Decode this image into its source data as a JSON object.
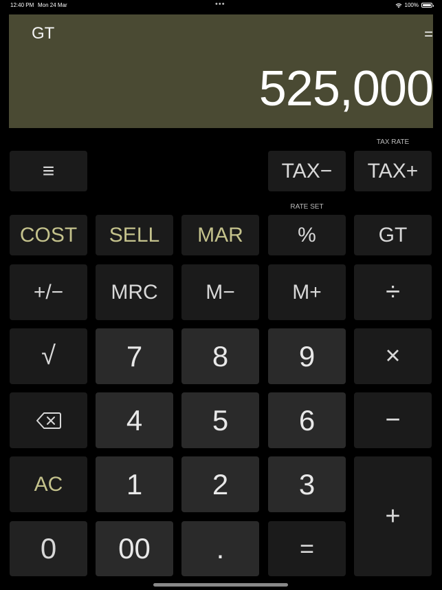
{
  "status_bar": {
    "time": "12:40 PM",
    "date": "Mon 24 Mar",
    "battery": "100%",
    "dots": "•••"
  },
  "display": {
    "gt_label": "GT",
    "eq_label": "=",
    "value": "525,000"
  },
  "captions": {
    "tax_rate": "TAX RATE",
    "rate_set": "RATE SET"
  },
  "keys": {
    "menu": "≡",
    "tax_minus": "TAX−",
    "tax_plus": "TAX+",
    "cost": "COST",
    "sell": "SELL",
    "mar": "MAR",
    "percent": "%",
    "gt": "GT",
    "plus_minus": "+/−",
    "mrc": "MRC",
    "m_minus": "M−",
    "m_plus": "M+",
    "divide": "÷",
    "sqrt": "√",
    "seven": "7",
    "eight": "8",
    "nine": "9",
    "multiply": "×",
    "four": "4",
    "five": "5",
    "six": "6",
    "minus": "−",
    "ac": "AC",
    "one": "1",
    "two": "2",
    "three": "3",
    "plus": "+",
    "zero": "0",
    "double_zero": "00",
    "decimal": ".",
    "equals": "="
  },
  "colors": {
    "display_bg": "#4a4a33",
    "gold_text": "#c4c28c",
    "key_bg": "#1b1b1b",
    "num_key_bg": "#2a2a2a"
  }
}
